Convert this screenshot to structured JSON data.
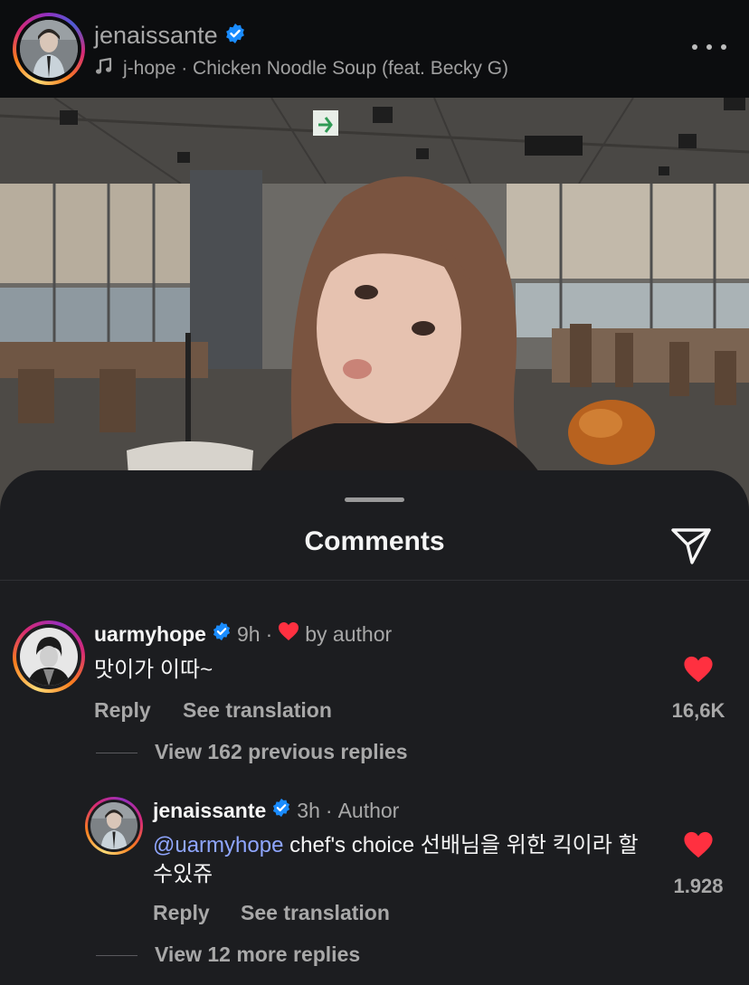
{
  "post": {
    "username": "jenaissante",
    "music_track": "j-hope · Chicken Noodle Soup (feat. Becky G)"
  },
  "icons": {
    "verified": "verified-badge-icon",
    "music": "music-note-icon",
    "more": "more-options-icon",
    "send": "send-icon",
    "like": "heart-icon"
  },
  "colors": {
    "verified": "#1a8cff",
    "like": "#ff3040",
    "mention": "#8fa6ff",
    "sheet_bg": "#1c1d20"
  },
  "comments_sheet": {
    "title": "Comments"
  },
  "comments": [
    {
      "username": "uarmyhope",
      "time": "9h",
      "separator": "·",
      "liked_by_author_label": "by author",
      "text": "맛이가 이따~",
      "reply_label": "Reply",
      "translate_label": "See translation",
      "like_count": "16,6K",
      "view_replies_label": "View 162 previous replies"
    }
  ],
  "replies": [
    {
      "username": "jenaissante",
      "time": "3h",
      "separator": "·",
      "author_tag": "Author",
      "mention": "@uarmyhope",
      "text": "chef's choice 선배님을 위한 킥이라 할수있쥬",
      "reply_label": "Reply",
      "translate_label": "See translation",
      "like_count": "1.928",
      "view_more_label": "View 12 more replies"
    }
  ]
}
